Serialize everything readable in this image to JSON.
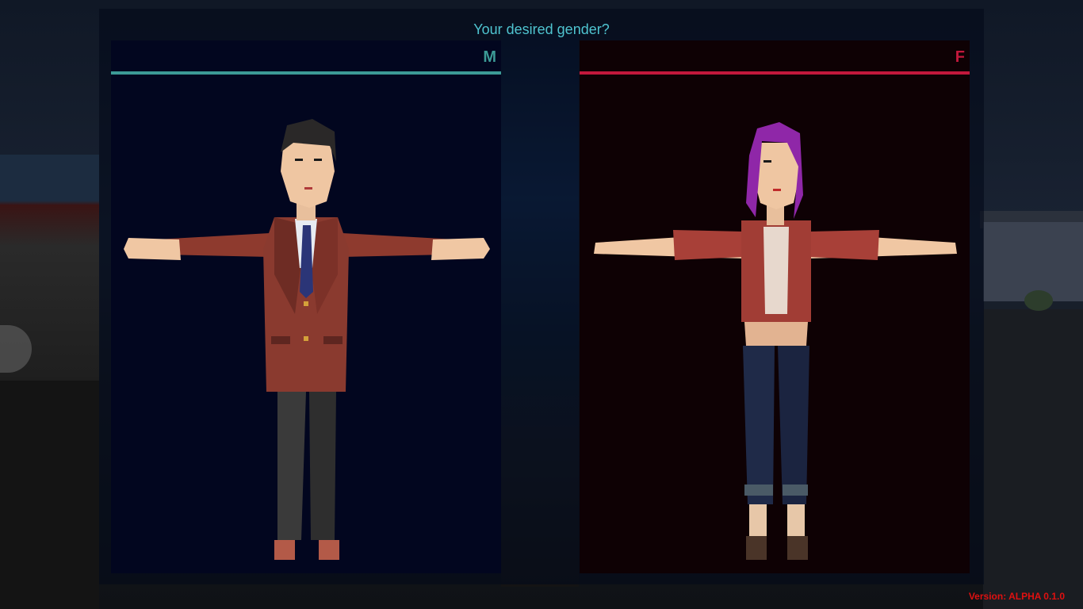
{
  "screen": {
    "title": "Your desired gender?",
    "version": "Version: ALPHA 0.1.0"
  },
  "options": [
    {
      "label": "M",
      "accent": "#3c9a96",
      "character": "male-character"
    },
    {
      "label": "F",
      "accent": "#c2183c",
      "character": "female-character"
    }
  ]
}
